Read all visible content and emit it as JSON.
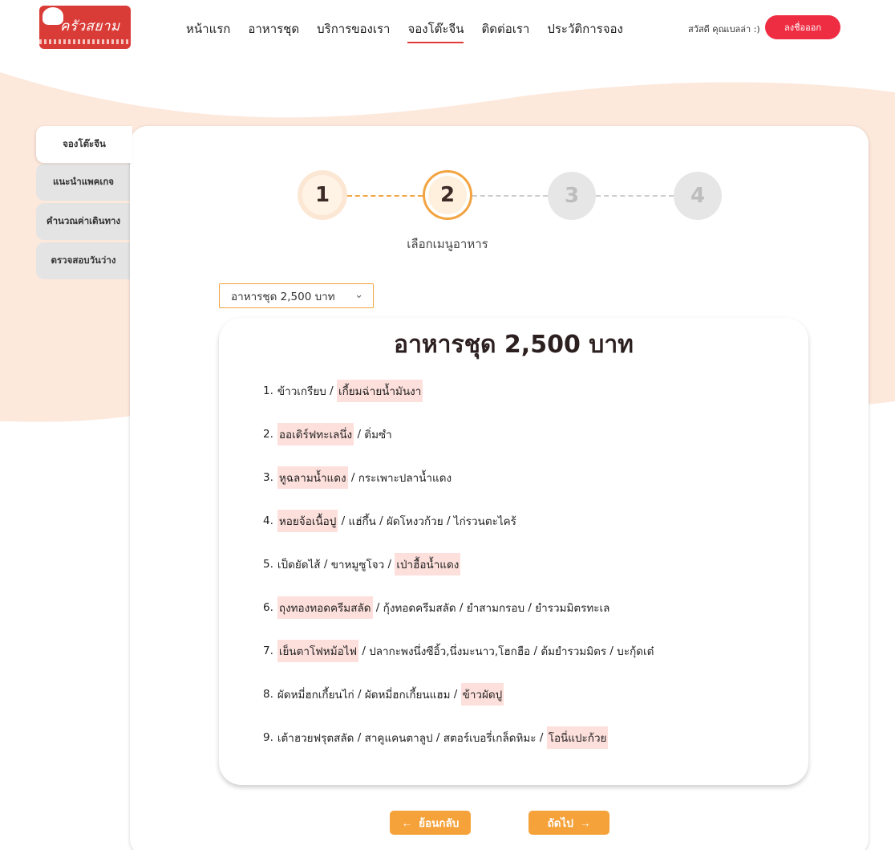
{
  "header": {
    "logo_text": "ครัวสยาม",
    "nav": [
      {
        "label": "หน้าแรก",
        "active": false
      },
      {
        "label": "อาหารชุด",
        "active": false
      },
      {
        "label": "บริการของเรา",
        "active": false
      },
      {
        "label": "จองโต๊ะจีน",
        "active": true
      },
      {
        "label": "ติดต่อเรา",
        "active": false
      },
      {
        "label": "ประวัติการจอง",
        "active": false
      }
    ],
    "greeting": "สวัสดี คุณเบลล่า :)",
    "logout_label": "ลงชื่อออก"
  },
  "sidebar": {
    "items": [
      {
        "label": "จองโต๊ะจีน",
        "active": true
      },
      {
        "label": "แนะนำแพคเกจ",
        "active": false
      },
      {
        "label": "คำนวณค่าเดินทาง",
        "active": false
      },
      {
        "label": "ตรวจสอบวันว่าง",
        "active": false
      }
    ]
  },
  "stepper": {
    "steps": [
      "1",
      "2",
      "3",
      "4"
    ],
    "current_step": 2,
    "caption": "เลือกเมนูอาหาร"
  },
  "dropdown": {
    "selected": "อาหารชุด 2,500 บาท"
  },
  "menu_card": {
    "title": "อาหารชุด 2,500 บาท",
    "items": [
      {
        "number": "1.",
        "parts": [
          {
            "text": "ข้าวเกรียบ",
            "hl": false
          },
          {
            "text": "เกี้ยมฉ่ายน้ำมันงา",
            "hl": true
          }
        ]
      },
      {
        "number": "2.",
        "parts": [
          {
            "text": "ออเดิร์ฟทะเลนึ่ง",
            "hl": true
          },
          {
            "text": "ติ่มซำ",
            "hl": false
          }
        ]
      },
      {
        "number": "3.",
        "parts": [
          {
            "text": "หูฉลามน้ำแดง",
            "hl": true
          },
          {
            "text": "กระเพาะปลาน้ำแดง",
            "hl": false
          }
        ]
      },
      {
        "number": "4.",
        "parts": [
          {
            "text": "หอยจ้อเนื้อปู",
            "hl": true
          },
          {
            "text": "แฮ่กึ้น",
            "hl": false
          },
          {
            "text": "ผัดโหงวก้วย",
            "hl": false
          },
          {
            "text": "ไก่รวนตะไคร้",
            "hl": false
          }
        ]
      },
      {
        "number": "5.",
        "parts": [
          {
            "text": "เป็ดยัดไส้",
            "hl": false
          },
          {
            "text": "ขาหมูซูโจว",
            "hl": false
          },
          {
            "text": "เป่าฮื้อน้ำแดง",
            "hl": true
          }
        ]
      },
      {
        "number": "6.",
        "parts": [
          {
            "text": "ถุงทองทอดครีมสลัด",
            "hl": true
          },
          {
            "text": "กุ้งทอดครีมสลัด",
            "hl": false
          },
          {
            "text": "ยำสามกรอบ",
            "hl": false
          },
          {
            "text": "ยำรวมมิตรทะเล",
            "hl": false
          }
        ]
      },
      {
        "number": "7.",
        "parts": [
          {
            "text": "เย็นตาโฟหม้อไฟ",
            "hl": true
          },
          {
            "text": "ปลากะพงนึ่งซีอิ้ว,นึ่งมะนาว,โฮกฮือ",
            "hl": false
          },
          {
            "text": "ต้มยำรวมมิตร",
            "hl": false
          },
          {
            "text": "บะกุ้ดเต๋",
            "hl": false
          }
        ]
      },
      {
        "number": "8.",
        "parts": [
          {
            "text": "ผัดหมี่ฮกเกี้ยนไก่",
            "hl": false
          },
          {
            "text": "ผัดหมี่ฮกเกี้ยนแฮม",
            "hl": false
          },
          {
            "text": "ข้าวผัดปู",
            "hl": true
          }
        ]
      },
      {
        "number": "9.",
        "parts": [
          {
            "text": "เต้าฮวยฟรุตสลัด",
            "hl": false
          },
          {
            "text": "สาคูแคนตาลูป",
            "hl": false
          },
          {
            "text": "สตอร์เบอรี่เกล็ดหิมะ",
            "hl": false
          },
          {
            "text": "โอนี่แปะก้วย",
            "hl": true
          }
        ]
      }
    ]
  },
  "buttons": {
    "back_label": "ย้อนกลับ",
    "next_label": "ถัดไป"
  },
  "colors": {
    "accent_orange": "#f3a340",
    "logout_red": "#ee2d42",
    "highlight_pink": "#fde0dc",
    "background_peach": "#fde8dc"
  }
}
